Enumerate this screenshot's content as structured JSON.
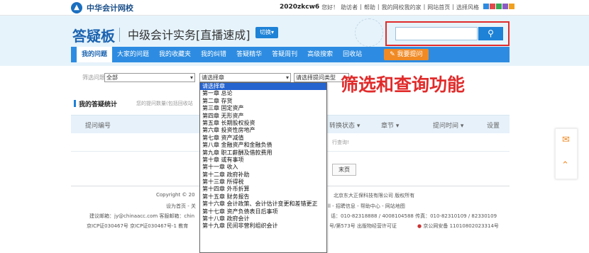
{
  "topbar": {
    "logo_text": "中华会计网校",
    "user": "2020zkcw6",
    "greeting": "您好！",
    "links": [
      "助访者",
      "帮助",
      "我的网校我的家",
      "网站首页",
      "选择风格"
    ],
    "style_colors": [
      "#2d8ce1",
      "#e14a4a",
      "#3aa856",
      "#8a5cc2",
      "#f0a020"
    ]
  },
  "header": {
    "brand": "答疑板",
    "course": "中级会计实务[直播速成]",
    "switch_label": "切换▾",
    "search": {
      "value": "",
      "button_icon": "search-icon"
    }
  },
  "nav": {
    "items": [
      "我的问题",
      "大家的问题",
      "我的收藏夹",
      "我的纠错",
      "答疑精华",
      "答疑周刊",
      "高级搜索",
      "回收站"
    ],
    "ask_button": "我要提问"
  },
  "filters": {
    "label": "筛选问题",
    "all_value": "全部",
    "chapter_value": "请选择章",
    "type_value": "请选择提问类型"
  },
  "annotation": "筛选和查询功能",
  "stats": {
    "title": "我的答疑统计",
    "note": "您的提问数量(包括回收站"
  },
  "table": {
    "headers": [
      "提问编号",
      "转换状态",
      "章节",
      "提问时间",
      "设置"
    ],
    "empty_text": "行查询!"
  },
  "pager": {
    "last_page": "末页"
  },
  "dropdown": {
    "options": [
      "请选择章",
      "第一章 总论",
      "第二章 存货",
      "第三章 固定资产",
      "第四章 无形资产",
      "第五章 长期股权投资",
      "第六章 投资性房地产",
      "第七章 资产减值",
      "第八章 金融资产和金融负债",
      "第九章 职工薪酬及借款费用",
      "第十章 或有事项",
      "第十一章 收入",
      "第十二章 政府补助",
      "第十三章 所得税",
      "第十四章 外币折算",
      "第十五章 财务报告",
      "第十六章 会计政策、会计估计变更和差错更正",
      "第十七章 资产负债表日后事项",
      "第十八章 政府会计",
      "第十九章 民间非营利组织会计"
    ],
    "selected_index": 0
  },
  "footer": {
    "copyright": "Copyright © 20",
    "company": "北京东大正保科技有限公司 版权所有",
    "line2_left": "设为首页 - 关",
    "line2_right": "ll - 招聘信息 - 帮助中心 - 网站地图",
    "line3_left": "建议邮箱：jy@chinaacc.com 客服邮箱：chin",
    "line3_right": "话：010-82318888 / 4008104588 传真：010-82310109 / 82330109",
    "line4_left": "京ICP证030467号 京ICP证030467号-1 教育",
    "line4_mid": "号/第573号 出版物经营许可证",
    "line4_right": "京公网安备 11010802023314号"
  }
}
